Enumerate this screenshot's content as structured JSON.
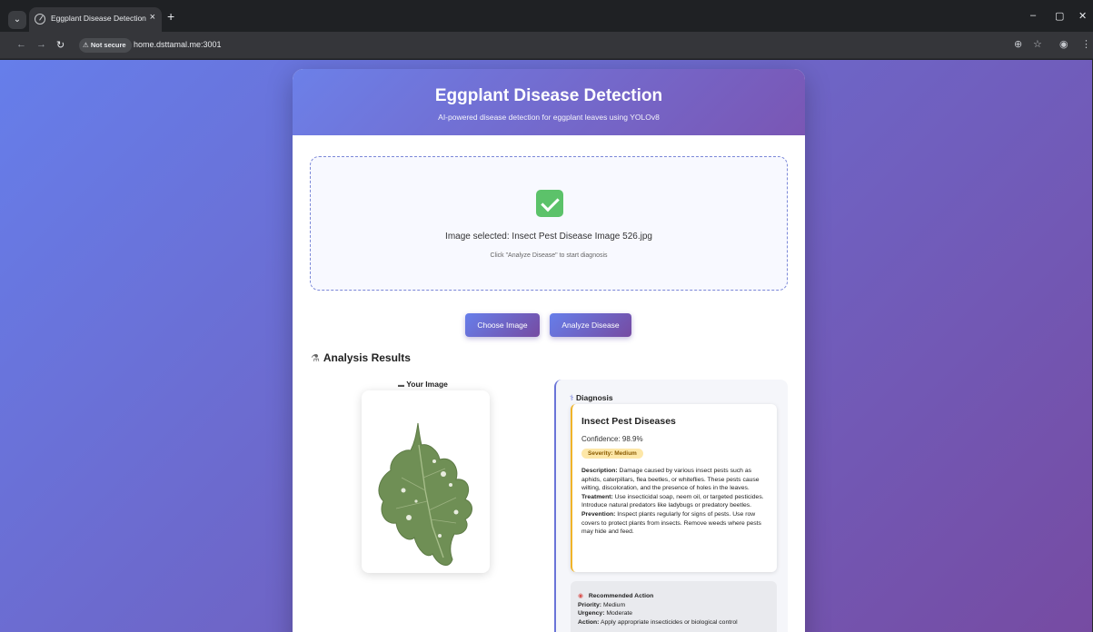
{
  "browser": {
    "tab_title": "Eggplant Disease Detection",
    "tab_close": "×",
    "new_tab": "+",
    "security_label": "Not secure",
    "url": "home.dsttamal.me:3001",
    "win_minimize": "–",
    "win_restore": "▢",
    "win_close": "✕"
  },
  "header": {
    "title": "Eggplant Disease Detection",
    "subtitle": "AI-powered disease detection for eggplant leaves using YOLOv8"
  },
  "upload": {
    "selected_text": "Image selected: Insect Pest Disease Image 526.jpg",
    "hint": "Click \"Analyze Disease\" to start diagnosis",
    "status_icon": "check-icon"
  },
  "buttons": {
    "choose": "Choose Image",
    "analyze": "Analyze Disease"
  },
  "results": {
    "title": "Analysis Results",
    "image_label": "Your Image",
    "diagnosis_label": "Diagnosis",
    "disease": "Insect Pest Diseases",
    "confidence": "Confidence: 98.9%",
    "severity": "Severity: Medium",
    "description_label": "Description:",
    "description": "Damage caused by various insect pests such as aphids, caterpillars, flea beetles, or whiteflies. These pests cause wilting, discoloration, and the presence of holes in the leaves.",
    "treatment_label": "Treatment:",
    "treatment": "Use insecticidal soap, neem oil, or targeted pesticides. Introduce natural predators like ladybugs or predatory beetles.",
    "prevention_label": "Prevention:",
    "prevention": "Inspect plants regularly for signs of pests. Use row covers to protect plants from insects. Remove weeds where pests may hide and feed.",
    "action_title": "Recommended Action",
    "priority_label": "Priority:",
    "priority": "Medium",
    "urgency_label": "Urgency:",
    "urgency": "Moderate",
    "action_label": "Action:",
    "action": "Apply appropriate insecticides or biological control"
  },
  "colors": {
    "gradient_start": "#667eea",
    "gradient_end": "#764ba2",
    "severity_bg": "#fde7a8",
    "check_green": "#5cc26a",
    "leaf_green": "#6f8f55"
  }
}
